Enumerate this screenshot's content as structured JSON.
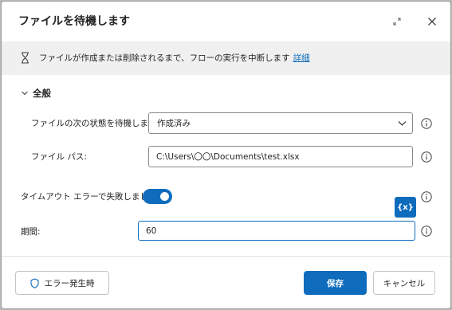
{
  "dialog": {
    "title": "ファイルを待機します",
    "expand_icon": "expand-arrows-icon",
    "close_icon": "close-icon"
  },
  "info_bar": {
    "icon": "hourglass-icon",
    "text": "ファイルが作成または削除されるまで、フローの実行を中断します",
    "link": "詳細"
  },
  "section": {
    "label": "全般",
    "icon": "chevron-down-icon"
  },
  "fields": {
    "wait_state": {
      "label": "ファイルの次の状態を待機します:",
      "value": "作成済み"
    },
    "file_path": {
      "label": "ファイル パス:",
      "value": "C:\\Users\\〇〇\\Documents\\test.xlsx"
    },
    "timeout": {
      "label": "タイムアウト エラーで失敗しました:",
      "enabled": true
    },
    "duration": {
      "label": "期間:",
      "value": "60"
    },
    "variable_button": "{x}"
  },
  "footer": {
    "on_error_label": "エラー発生時",
    "save_label": "保存",
    "cancel_label": "キャンセル"
  },
  "colors": {
    "accent": "#0f6cbd",
    "info_bar_bg": "#f0f0f0",
    "text": "#242424"
  }
}
